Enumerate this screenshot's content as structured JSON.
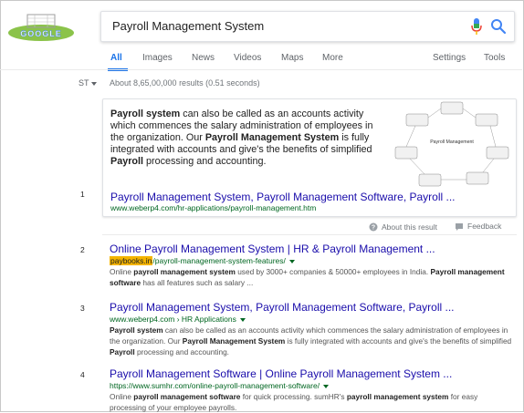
{
  "logo": {
    "text": "GOOGLE",
    "colors": [
      "#4285f4",
      "#ea4335",
      "#fbbc05",
      "#34a853"
    ]
  },
  "search": {
    "query": "Payroll Management System"
  },
  "tabs": [
    {
      "label": "All",
      "active": true
    },
    {
      "label": "Images"
    },
    {
      "label": "News"
    },
    {
      "label": "Videos"
    },
    {
      "label": "Maps"
    },
    {
      "label": "More"
    },
    {
      "label": "Settings"
    },
    {
      "label": "Tools"
    }
  ],
  "stats": {
    "label": "ST",
    "text": "About 8,65,00,000 results (0.51 seconds)"
  },
  "snippet": {
    "body_parts": [
      {
        "text": "Payroll system",
        "bold": true
      },
      {
        "text": " can also be called as an accounts activity which commences the salary administration of employees in the organization. Our "
      },
      {
        "text": "Payroll Management System",
        "bold": true
      },
      {
        "text": " is fully integrated with accounts and give's the benefits of simplified "
      },
      {
        "text": "Payroll",
        "bold": true
      },
      {
        "text": " processing and accounting."
      }
    ],
    "diagram_center": "Payroll Management",
    "title": "Payroll Management System, Payroll Management Software, Payroll ...",
    "url": "www.weberp4.com/hr-applications/payroll-management.htm",
    "number": "1"
  },
  "about_label": "About this result",
  "feedback_label": "Feedback",
  "results": [
    {
      "number": "2",
      "title": "Online Payroll Management System | HR & Payroll Management ...",
      "url_highlight": "paybooks.in",
      "url_rest": "/payroll-management-system-features/",
      "snippet_parts": [
        {
          "text": "Online "
        },
        {
          "text": "payroll management system",
          "bold": true
        },
        {
          "text": " used by 3000+ companies & 50000+ employees in India. "
        },
        {
          "text": "Payroll management software",
          "bold": true
        },
        {
          "text": " has all features such as salary ..."
        }
      ]
    },
    {
      "number": "3",
      "title": "Payroll Management System, Payroll Management Software, Payroll ...",
      "url_highlight": "",
      "url_rest": "www.weberp4.com › HR Applications",
      "snippet_parts": [
        {
          "text": "Payroll system",
          "bold": true
        },
        {
          "text": " can also be called as an accounts activity which commences the salary administration of employees in the organization. Our "
        },
        {
          "text": "Payroll Management System",
          "bold": true
        },
        {
          "text": " is fully integrated with accounts and give's the benefits of simplified "
        },
        {
          "text": "Payroll",
          "bold": true
        },
        {
          "text": " processing and accounting."
        }
      ]
    },
    {
      "number": "4",
      "title": "Payroll Management Software | Online Payroll Management System ...",
      "url_highlight": "",
      "url_rest": "https://www.sumhr.com/online-payroll-management-software/",
      "snippet_parts": [
        {
          "text": "Online "
        },
        {
          "text": "payroll management software",
          "bold": true
        },
        {
          "text": " for quick processing. sumHR's "
        },
        {
          "text": "payroll management system",
          "bold": true
        },
        {
          "text": " for easy processing of your employee payrolls."
        }
      ]
    }
  ]
}
